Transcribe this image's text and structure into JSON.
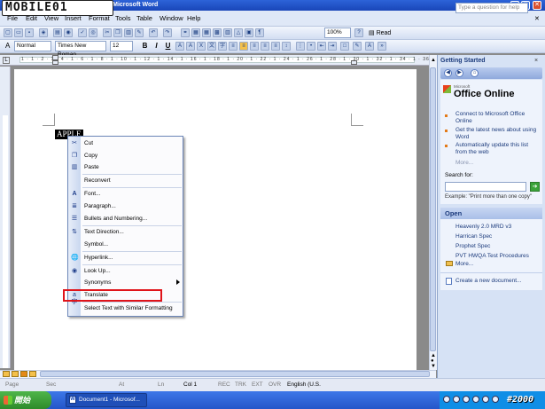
{
  "logo": {
    "text": "MOBILE01"
  },
  "window": {
    "title": "ument1 - Microsoft Word"
  },
  "menu": {
    "items": [
      "File",
      "Edit",
      "View",
      "Insert",
      "Format",
      "Tools",
      "Table",
      "Window",
      "Help"
    ],
    "help_placeholder": "Type a question for help"
  },
  "toolbar_standard": {
    "zoom": "100%",
    "read_label": "Read"
  },
  "toolbar_formatting": {
    "style": "Normal",
    "font": "Times New Roman",
    "size": "12",
    "bold": "B",
    "italic": "I",
    "underline": "U"
  },
  "ruler": {
    "numbers": "1 · 1 · 2 · 1 · 4 · 1 · 6 · 1 · 8 · 1 · 10 · 1 · 12 · 1 · 14 · 1 · 16 · 1 · 18 · 1 · 20 · 1 · 22 · 1 · 24 · 1 · 26 · 1 · 28 · 1 · 30 · 1 · 32 · 1 · 34 · 1 · 36"
  },
  "document": {
    "selected_text": "APPLE"
  },
  "context_menu": {
    "items": [
      {
        "label": "Cut",
        "icon": "scissors-icon"
      },
      {
        "label": "Copy",
        "icon": "copy-icon"
      },
      {
        "label": "Paste",
        "icon": "paste-icon"
      },
      {
        "label": "Reconvert",
        "icon": ""
      },
      {
        "label": "Font...",
        "icon": "font-icon"
      },
      {
        "label": "Paragraph...",
        "icon": "paragraph-icon"
      },
      {
        "label": "Bullets and Numbering...",
        "icon": "bullets-icon"
      },
      {
        "label": "Text Direction...",
        "icon": "text-direction-icon"
      },
      {
        "label": "Symbol...",
        "icon": ""
      },
      {
        "label": "Hyperlink...",
        "icon": "hyperlink-icon"
      },
      {
        "label": "Look Up...",
        "icon": "lookup-icon"
      },
      {
        "label": "Synonyms",
        "icon": ""
      },
      {
        "label": "Translate",
        "icon": "translate-icon"
      },
      {
        "label": "Select Text with Similar Formatting",
        "icon": ""
      }
    ]
  },
  "task_pane": {
    "title": "Getting Started",
    "close": "×",
    "brand": "Office Online",
    "brand_small": "Microsoft",
    "links": [
      "Connect to Microsoft Office Online",
      "Get the latest news about using Word",
      "Automatically update this list from the web"
    ],
    "more": "More...",
    "search_label": "Search for:",
    "search_go": "➔",
    "search_example": "Example:  \"Print more than one copy\"",
    "open_title": "Open",
    "open_files": [
      "Heavenly 2.0 MRD v3",
      "Harrican Spec",
      "Prophet Spec",
      "PVT HWQA Test Procedures"
    ],
    "open_more": "More...",
    "create_new": "Create a new document..."
  },
  "status_bar": {
    "page": "Page",
    "sec": "Sec",
    "at": "At",
    "ln": "Ln",
    "col": "Col 1",
    "rec": "REC",
    "trk": "TRK",
    "ext": "EXT",
    "ovr": "OVR",
    "lang": "English (U.S."
  },
  "taskbar": {
    "start": "開始",
    "word_task": "Document1 - Microsof...",
    "watermark": "#2000"
  },
  "colors": {
    "title_blue": "#1946b8",
    "highlight_red": "#e0141a",
    "pane_bg": "#d6e2f5"
  }
}
